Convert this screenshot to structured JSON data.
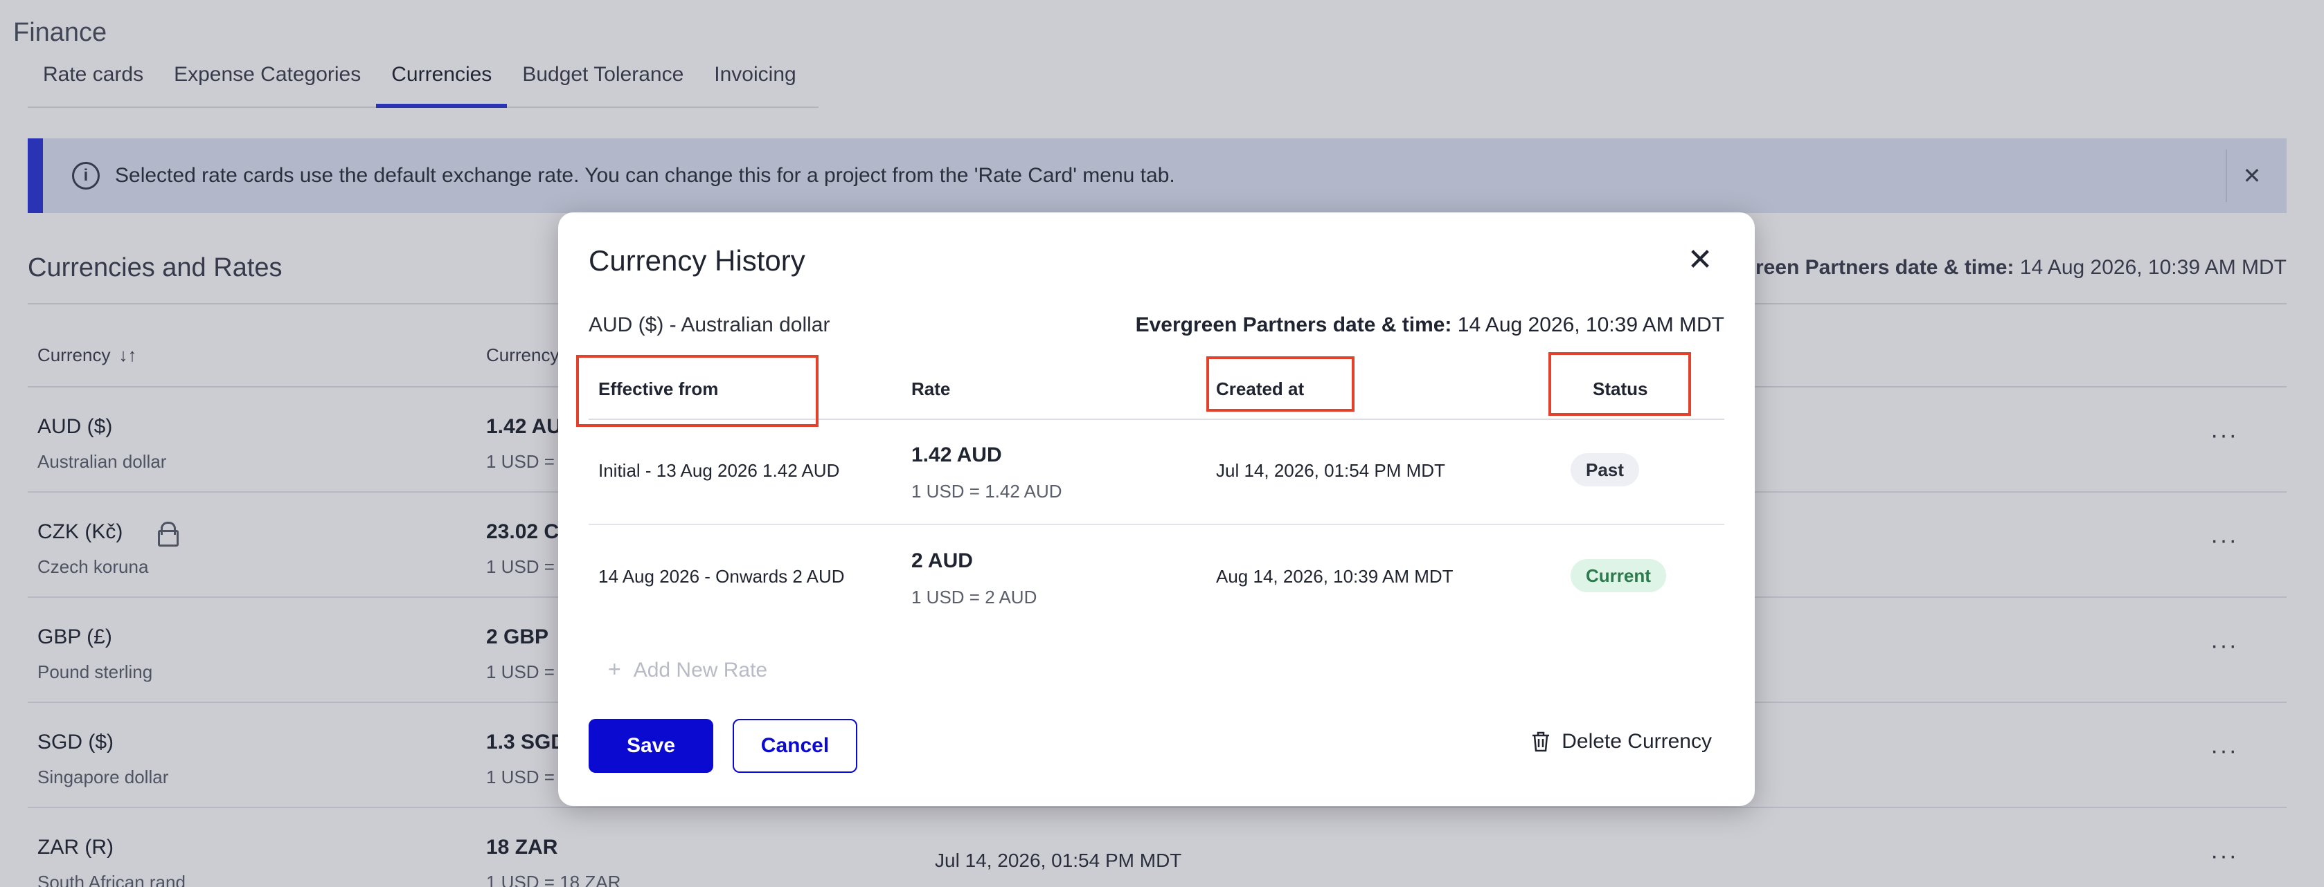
{
  "app": {
    "title": "Finance"
  },
  "tabs": [
    {
      "label": "Rate cards"
    },
    {
      "label": "Expense Categories"
    },
    {
      "label": "Currencies"
    },
    {
      "label": "Budget Tolerance"
    },
    {
      "label": "Invoicing"
    }
  ],
  "banner": {
    "text": "Selected rate cards use the default exchange rate. You can change this for a project from the 'Rate Card' menu tab."
  },
  "section": {
    "title": "Currencies and Rates",
    "meta_label": "reen Partners date & time:",
    "meta_value": " 14 Aug 2026, 10:39 AM MDT"
  },
  "currencies_table": {
    "headers": {
      "currency": "Currency",
      "rate": "Currency"
    },
    "rows": [
      {
        "code": "AUD ($)",
        "name": "Australian dollar",
        "rate": "1.42 AU",
        "conv": "1 USD =",
        "date": ""
      },
      {
        "code": "CZK (Kč)",
        "name": "Czech koruna",
        "rate": "23.02 C",
        "conv": "1 USD =",
        "date": ""
      },
      {
        "code": "GBP (£)",
        "name": "Pound sterling",
        "rate": "2 GBP",
        "conv": "1 USD =",
        "date": ""
      },
      {
        "code": "SGD ($)",
        "name": "Singapore dollar",
        "rate": "1.3 SGD",
        "conv": "1 USD =",
        "date": ""
      },
      {
        "code": "ZAR (R)",
        "name": "South African rand",
        "rate": "18 ZAR",
        "conv": "1 USD = 18 ZAR",
        "date": "Jul 14, 2026, 01:54 PM MDT"
      }
    ]
  },
  "modal": {
    "title": "Currency History",
    "subtitle": "AUD ($) - Australian dollar",
    "meta_label": "Evergreen Partners date & time:",
    "meta_value": " 14 Aug 2026, 10:39 AM MDT",
    "headers": {
      "effective_from": "Effective from",
      "rate": "Rate",
      "created_at": "Created at",
      "status": "Status"
    },
    "rows": [
      {
        "effective": "Initial - 13 Aug 2026  1.42 AUD",
        "rate": "1.42 AUD",
        "conv": "1 USD = 1.42 AUD",
        "created": "Jul 14, 2026, 01:54 PM MDT",
        "status": "Past"
      },
      {
        "effective": "14 Aug 2026 - Onwards  2 AUD",
        "rate": "2 AUD",
        "conv": "1 USD = 2 AUD",
        "created": "Aug 14, 2026, 10:39 AM MDT",
        "status": "Current"
      }
    ],
    "add_rate_label": "Add New Rate",
    "save_label": "Save",
    "cancel_label": "Cancel",
    "delete_label": "Delete Currency"
  },
  "colors": {
    "accent": "#2b35d6",
    "primary_button": "#0a0ad0",
    "highlight": "#e2412c",
    "current_badge": "#ddf4e6",
    "past_badge": "#eeeff4"
  }
}
